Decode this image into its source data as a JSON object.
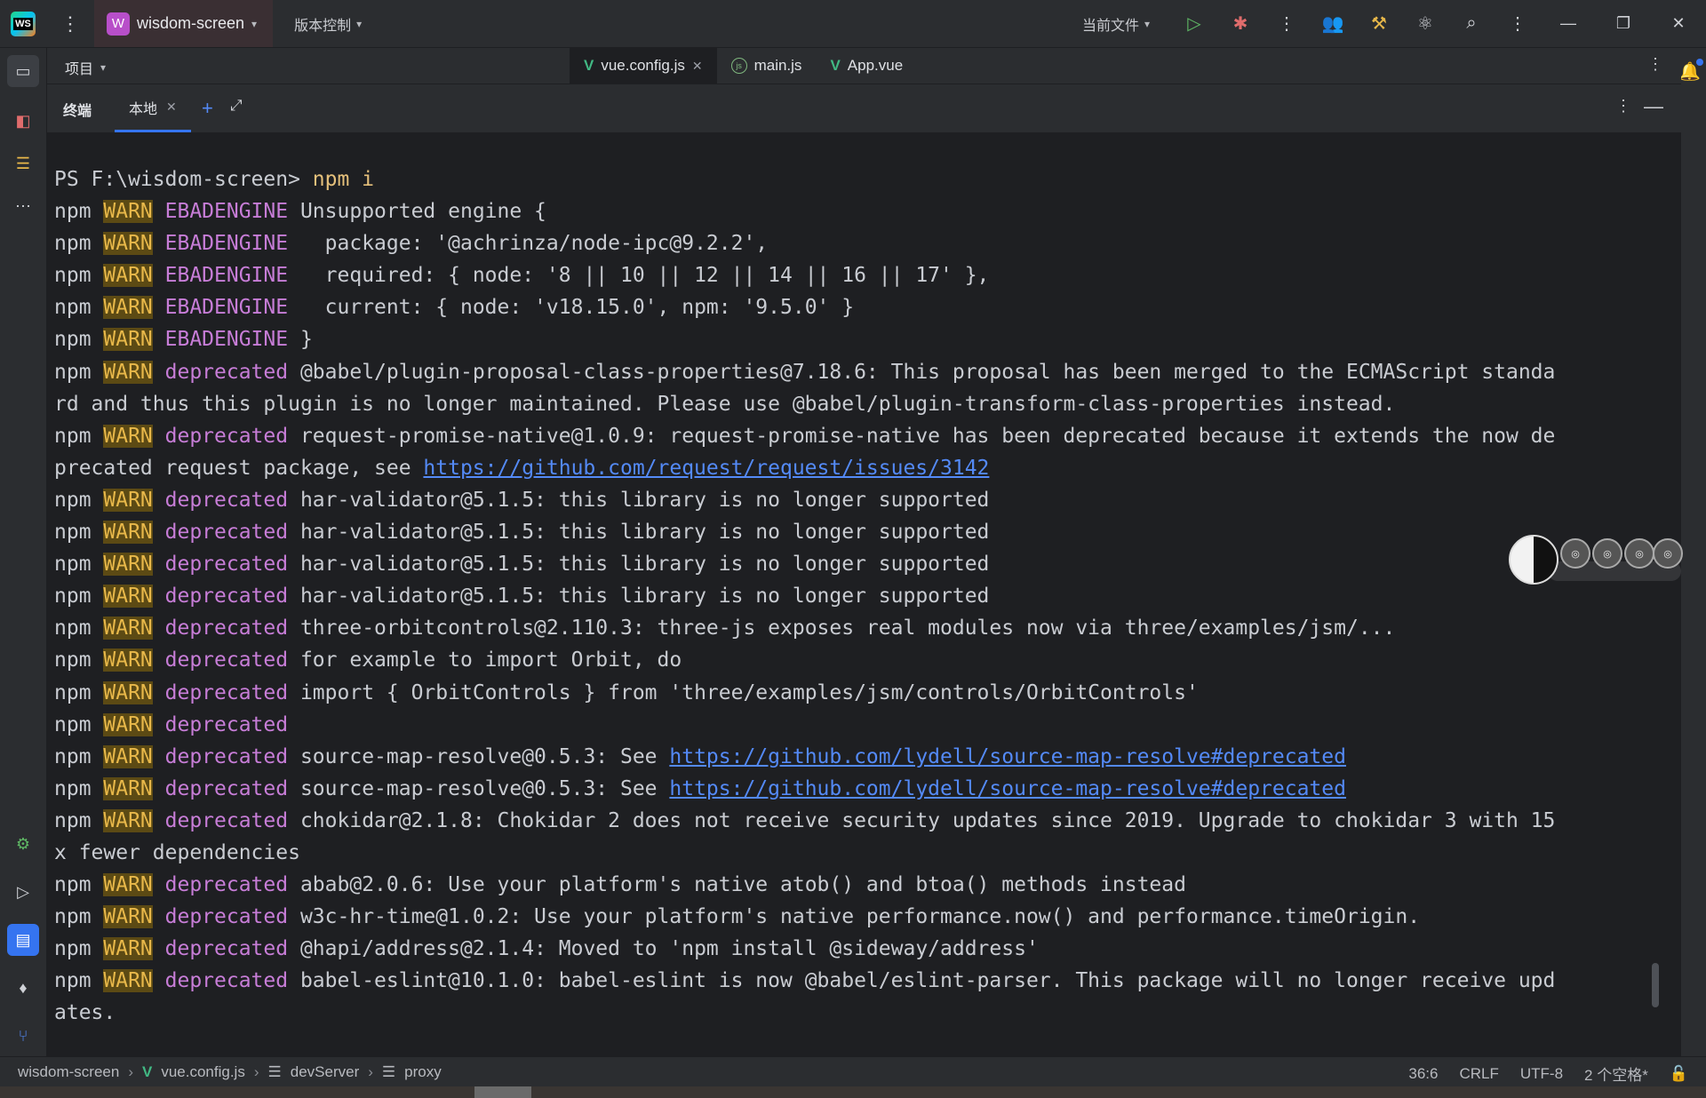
{
  "titlebar": {
    "project_badge": "W",
    "project_name": "wisdom-screen",
    "vcs_label": "版本控制",
    "current_file_label": "当前文件"
  },
  "editor": {
    "project_label": "项目",
    "tabs": [
      {
        "label": "vue.config.js",
        "icon": "vue-icon",
        "active": true
      },
      {
        "label": "main.js",
        "icon": "js-icon",
        "active": false
      },
      {
        "label": "App.vue",
        "icon": "vue-icon",
        "active": false
      }
    ]
  },
  "terminal": {
    "title": "终端",
    "tab_label": "本地",
    "lines": [
      {
        "type": "prompt",
        "prompt": "PS F:\\wisdom-screen> ",
        "cmd": "npm i"
      },
      {
        "type": "warn",
        "kind": "EBADENGINE",
        "text": " Unsupported engine {"
      },
      {
        "type": "warn",
        "kind": "EBADENGINE",
        "text": "   package: '@achrinza/node-ipc@9.2.2',"
      },
      {
        "type": "warn",
        "kind": "EBADENGINE",
        "text": "   required: { node: '8 || 10 || 12 || 14 || 16 || 17' },"
      },
      {
        "type": "warn",
        "kind": "EBADENGINE",
        "text": "   current: { node: 'v18.15.0', npm: '9.5.0' }"
      },
      {
        "type": "warn",
        "kind": "EBADENGINE",
        "text": " }"
      },
      {
        "type": "warn",
        "kind": "deprecated",
        "text": " @babel/plugin-proposal-class-properties@7.18.6: This proposal has been merged to the ECMAScript standa"
      },
      {
        "type": "plain",
        "text": "rd and thus this plugin is no longer maintained. Please use @babel/plugin-transform-class-properties instead."
      },
      {
        "type": "warn",
        "kind": "deprecated",
        "text": " request-promise-native@1.0.9: request-promise-native has been deprecated because it extends the now de"
      },
      {
        "type": "plainlink",
        "text": "precated request package, see ",
        "link": "https://github.com/request/request/issues/3142"
      },
      {
        "type": "warn",
        "kind": "deprecated",
        "text": " har-validator@5.1.5: this library is no longer supported"
      },
      {
        "type": "warn",
        "kind": "deprecated",
        "text": " har-validator@5.1.5: this library is no longer supported"
      },
      {
        "type": "warn",
        "kind": "deprecated",
        "text": " har-validator@5.1.5: this library is no longer supported"
      },
      {
        "type": "warn",
        "kind": "deprecated",
        "text": " har-validator@5.1.5: this library is no longer supported"
      },
      {
        "type": "warn",
        "kind": "deprecated",
        "text": " three-orbitcontrols@2.110.3: three-js exposes real modules now via three/examples/jsm/..."
      },
      {
        "type": "warn",
        "kind": "deprecated",
        "text": " for example to import Orbit, do"
      },
      {
        "type": "warn",
        "kind": "deprecated",
        "text": " import { OrbitControls } from 'three/examples/jsm/controls/OrbitControls'"
      },
      {
        "type": "warn",
        "kind": "deprecated",
        "text": ""
      },
      {
        "type": "warn",
        "kind": "deprecated",
        "text": " source-map-resolve@0.5.3: See ",
        "link": "https://github.com/lydell/source-map-resolve#deprecated"
      },
      {
        "type": "warn",
        "kind": "deprecated",
        "text": " source-map-resolve@0.5.3: See ",
        "link": "https://github.com/lydell/source-map-resolve#deprecated"
      },
      {
        "type": "warn",
        "kind": "deprecated",
        "text": " chokidar@2.1.8: Chokidar 2 does not receive security updates since 2019. Upgrade to chokidar 3 with 15"
      },
      {
        "type": "plain",
        "text": "x fewer dependencies"
      },
      {
        "type": "warn",
        "kind": "deprecated",
        "text": " abab@2.0.6: Use your platform's native atob() and btoa() methods instead"
      },
      {
        "type": "warn",
        "kind": "deprecated",
        "text": " w3c-hr-time@1.0.2: Use your platform's native performance.now() and performance.timeOrigin."
      },
      {
        "type": "warn",
        "kind": "deprecated",
        "text": " @hapi/address@2.1.4: Moved to 'npm install @sideway/address'"
      },
      {
        "type": "warn",
        "kind": "deprecated",
        "text": " babel-eslint@10.1.0: babel-eslint is now @babel/eslint-parser. This package will no longer receive upd"
      },
      {
        "type": "plain",
        "text": "ates."
      }
    ],
    "npm_label": "npm ",
    "warn_label": "WARN"
  },
  "statusbar": {
    "crumbs": [
      "wisdom-screen",
      "vue.config.js",
      "devServer",
      "proxy"
    ],
    "position": "36:6",
    "line_ending": "CRLF",
    "encoding": "UTF-8",
    "indent": "2 个空格*"
  },
  "colors": {
    "accent": "#3574f0",
    "warn_bg": "#5c4a14",
    "warn_fg": "#e8b84a",
    "deprecated": "#c77dd7",
    "link": "#548af7"
  }
}
